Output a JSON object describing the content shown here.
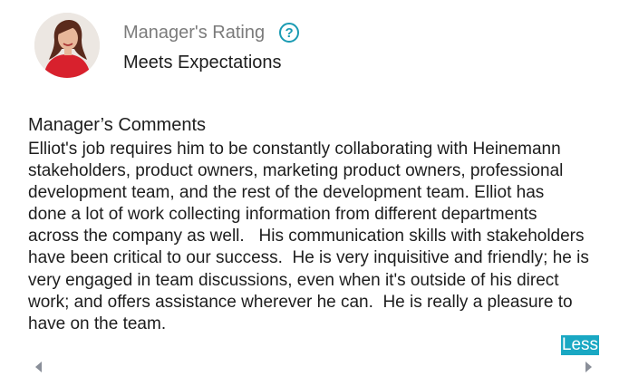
{
  "rating": {
    "title": "Manager's Rating",
    "value": "Meets Expectations",
    "help_icon": "question-circle-icon"
  },
  "comments": {
    "title": "Manager’s Comments",
    "body": "Elliot's job requires him to be constantly collaborating with Heinemann\nstakeholders, product owners, marketing product owners, professional\ndevelopment team, and the rest of the development team. Elliot has\ndone a lot of work collecting information from different departments\nacross the company as well.   His communication skills with stakeholders\nhave been critical to our success.  He is very inquisitive and friendly; he is\nvery engaged in team discussions, even when it's outside of his direct\nwork; and offers assistance wherever he can.  He is really a pleasure to\nhave on the team."
  },
  "less_label": "Less",
  "colors": {
    "accent": "#1aa8c3",
    "help_icon": "#1a9bb3",
    "muted_text": "#7b7b7b",
    "text": "#1d1d1d",
    "nav_arrow": "#8a8f99"
  }
}
